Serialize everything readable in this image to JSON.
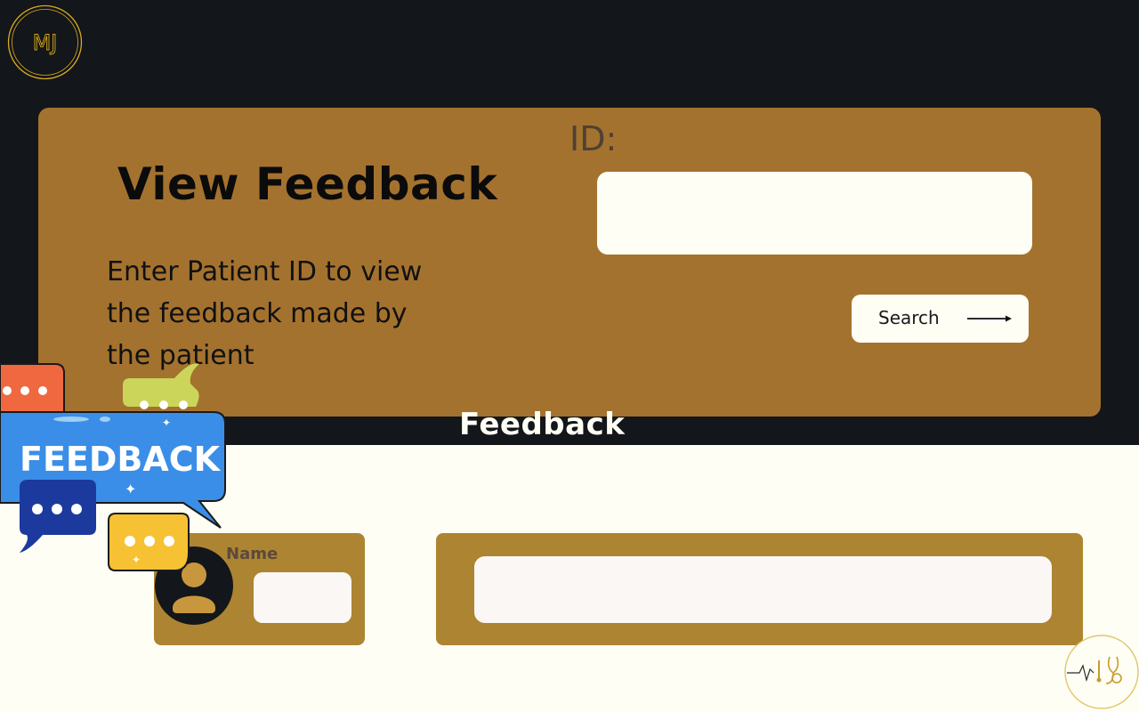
{
  "brand": {
    "monogram": "MJ",
    "accent": "#d9aa1e"
  },
  "hero": {
    "title": "View Feedback",
    "instructions": "Enter  Patient ID to view the feedback made by the patient",
    "id_label": "ID:",
    "id_value": ""
  },
  "search": {
    "label": "Search",
    "icon": "arrow-right-icon"
  },
  "section": {
    "heading": "Feedback"
  },
  "sticker": {
    "text": "FEEDBACK"
  },
  "feedback_entry": {
    "name_label": "Name",
    "name_value": "",
    "feedback_value": "",
    "avatar_icon": "user-icon"
  },
  "footer": {
    "logo_icon": "stethoscope-heartbeat-icon"
  },
  "colors": {
    "dark_bg": "#13161a",
    "hero_card": "#a4722f",
    "entry_card": "#ad8431",
    "light_bg": "#fefef4"
  }
}
